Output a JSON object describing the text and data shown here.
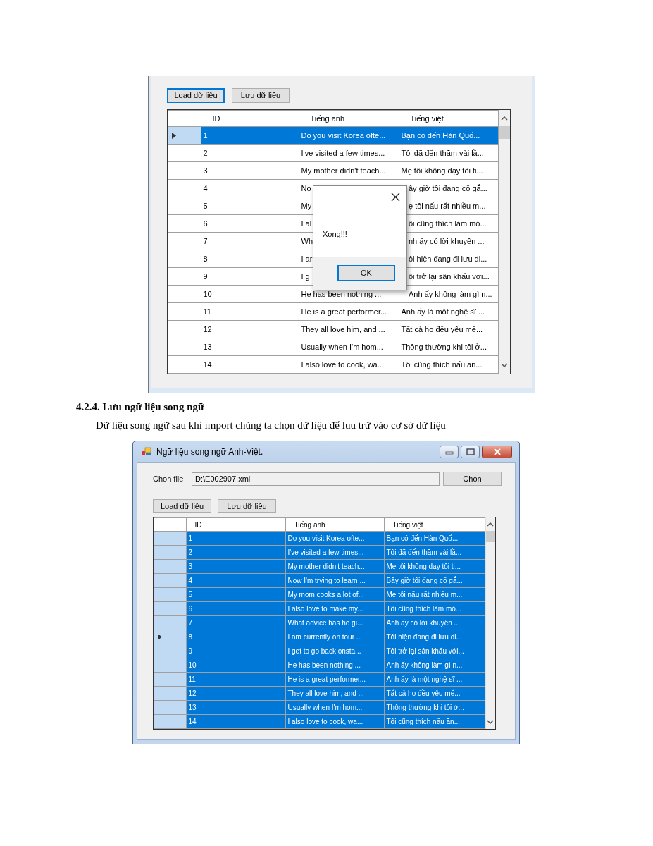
{
  "figure_1": {
    "buttons": [
      {
        "label": "Load dữ liệu",
        "focused": true
      },
      {
        "label": "Lưu dữ liệu",
        "focused": false
      }
    ],
    "grid": {
      "columns": [
        "ID",
        "Tiếng anh",
        "Tiếng việt"
      ],
      "rows": [
        {
          "cells": [
            "1",
            "Do you visit Korea ofte...",
            "Bạn có đến Hàn Quố..."
          ],
          "selected": true,
          "current": true
        },
        {
          "cells": [
            "2",
            "I've visited a few times...",
            "Tôi đã đến thăm vài lầ..."
          ],
          "selected": false,
          "current": false
        },
        {
          "cells": [
            "3",
            "My mother didn't teach...",
            "Mẹ tôi không dạy tôi ti..."
          ],
          "selected": false,
          "current": false
        },
        {
          "cells": [
            "4",
            "No",
            "ây giờ tôi đang cố gắ..."
          ],
          "selected": false,
          "current": false
        },
        {
          "cells": [
            "5",
            "My",
            "ẹ tôi nấu rất nhiều m..."
          ],
          "selected": false,
          "current": false
        },
        {
          "cells": [
            "6",
            "I al",
            "ôi cũng thích làm mó..."
          ],
          "selected": false,
          "current": false
        },
        {
          "cells": [
            "7",
            "Wh",
            "nh ấy có lời khuyên ..."
          ],
          "selected": false,
          "current": false
        },
        {
          "cells": [
            "8",
            "I ar",
            "ôi hiện đang đi lưu di..."
          ],
          "selected": false,
          "current": false
        },
        {
          "cells": [
            "9",
            "I g",
            "ôi trở lại sân khấu với..."
          ],
          "selected": false,
          "current": false
        },
        {
          "cells": [
            "10",
            "He has been nothing ...",
            "Anh ấy không làm gì n..."
          ],
          "selected": false,
          "current": false
        },
        {
          "cells": [
            "11",
            "He is a great performer...",
            "Anh ấy là một nghệ sĩ  ..."
          ],
          "selected": false,
          "current": false
        },
        {
          "cells": [
            "12",
            "They all love him, and ...",
            "Tất cả họ đều yêu mế..."
          ],
          "selected": false,
          "current": false
        },
        {
          "cells": [
            "13",
            "Usually when I'm hom...",
            "Thông thường khi tôi ở..."
          ],
          "selected": false,
          "current": false
        },
        {
          "cells": [
            "14",
            "I also love to cook, wa...",
            "Tôi cũng thích nấu ăn..."
          ],
          "selected": false,
          "current": false
        }
      ]
    },
    "dialog": {
      "message": "Xong!!!",
      "ok_button": {
        "label": "OK",
        "focused": true
      }
    }
  },
  "heading": "4.2.4. Lưu ngữ liệu song ngữ",
  "paragraph": "Dữ liệu song ngữ sau khi import chúng ta chọn dữ liệu để luu trữ vào cơ sở dữ liệu",
  "figure_2": {
    "window": {
      "title": "Ngữ liệu song ngữ Anh-Việt."
    },
    "file_label": "Chon file",
    "file_path": "D:\\E002907.xml",
    "browse_button": "Chon",
    "buttons": [
      {
        "label": "Load dữ liệu",
        "focused": false
      },
      {
        "label": "Lưu dữ liệu",
        "focused": false
      }
    ],
    "grid": {
      "columns": [
        "ID",
        "Tiếng anh",
        "Tiếng việt"
      ],
      "rows": [
        {
          "cells": [
            "1",
            "Do you visit Korea ofte...",
            "Bạn có đến Hàn Quố..."
          ],
          "selected": true,
          "current": false
        },
        {
          "cells": [
            "2",
            "I've visited a few times...",
            "Tôi đã đến thăm vài lầ..."
          ],
          "selected": true,
          "current": false
        },
        {
          "cells": [
            "3",
            "My mother didn't teach...",
            "Mẹ tôi không dạy tôi ti..."
          ],
          "selected": true,
          "current": false
        },
        {
          "cells": [
            "4",
            "Now I'm trying to learn ...",
            "Bây giờ tôi đang cố gắ..."
          ],
          "selected": true,
          "current": false
        },
        {
          "cells": [
            "5",
            "My mom cooks a lot of...",
            "Mẹ tôi nấu rất nhiều m..."
          ],
          "selected": true,
          "current": false
        },
        {
          "cells": [
            "6",
            "I also love to make my...",
            "Tôi cũng thích làm mó..."
          ],
          "selected": true,
          "current": false
        },
        {
          "cells": [
            "7",
            "What advice has he gi...",
            "Anh ấy có lời khuyên ..."
          ],
          "selected": true,
          "current": false
        },
        {
          "cells": [
            "8",
            "I am currently on tour ...",
            "Tôi hiện đang đi lưu di..."
          ],
          "selected": true,
          "current": true
        },
        {
          "cells": [
            "9",
            "I get to go back onsta...",
            "Tôi trở lại sân khấu với..."
          ],
          "selected": true,
          "current": false
        },
        {
          "cells": [
            "10",
            "He has been nothing ...",
            "Anh ấy không làm gì n..."
          ],
          "selected": true,
          "current": false
        },
        {
          "cells": [
            "11",
            "He is a great performer...",
            "Anh ấy là một nghệ sĩ  ..."
          ],
          "selected": true,
          "current": false
        },
        {
          "cells": [
            "12",
            "They all love him, and ...",
            "Tất cả họ đều yêu mế..."
          ],
          "selected": true,
          "current": false
        },
        {
          "cells": [
            "13",
            "Usually when I'm hom...",
            "Thông thường khi tôi ở..."
          ],
          "selected": true,
          "current": false
        },
        {
          "cells": [
            "14",
            "I also love to cook, wa...",
            "Tôi cũng thích nấu ăn..."
          ],
          "selected": true,
          "current": false
        }
      ]
    }
  }
}
